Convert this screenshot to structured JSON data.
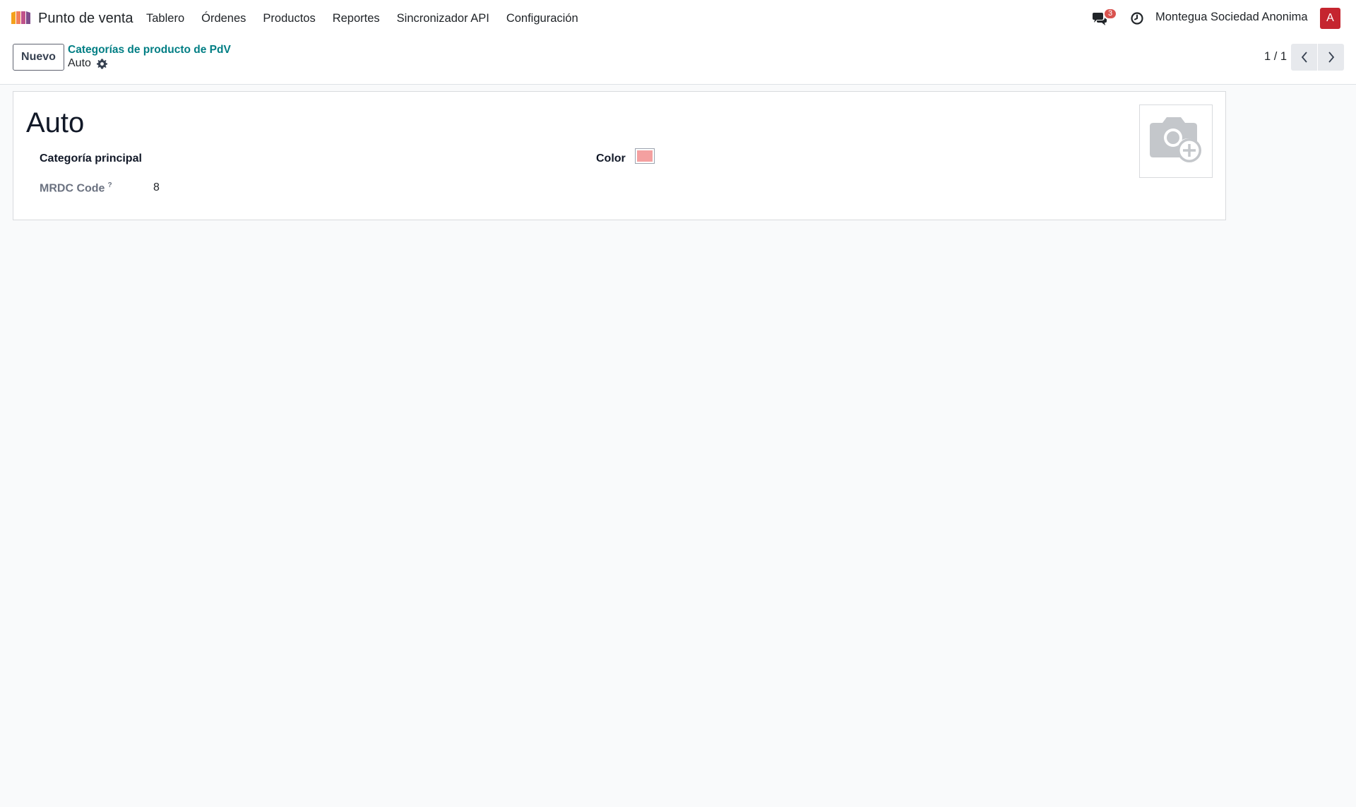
{
  "navbar": {
    "app_name": "Punto de venta",
    "menu": [
      "Tablero",
      "Órdenes",
      "Productos",
      "Reportes",
      "Sincronizador API",
      "Configuración"
    ],
    "chat_count": "3",
    "company": "Montegua Sociedad Anonima",
    "avatar_letter": "A"
  },
  "control_panel": {
    "new_label": "Nuevo",
    "breadcrumb_parent": "Categorías de producto de PdV",
    "breadcrumb_current": "Auto",
    "pager": "1 / 1"
  },
  "form": {
    "title": "Auto",
    "parent_category_label": "Categoría principal",
    "parent_category_value": "",
    "mrdc_label": "MRDC Code",
    "mrdc_help": "?",
    "mrdc_value": "8",
    "color_label": "Color",
    "color_value": "#f4a0a0"
  },
  "icons": {
    "app_logo": "pos-logo-icon",
    "chat": "chat-icon",
    "clock": "clock-icon",
    "gear": "gear-icon",
    "prev": "chevron-left-icon",
    "next": "chevron-right-icon",
    "image_placeholder": "camera-plus-icon"
  }
}
